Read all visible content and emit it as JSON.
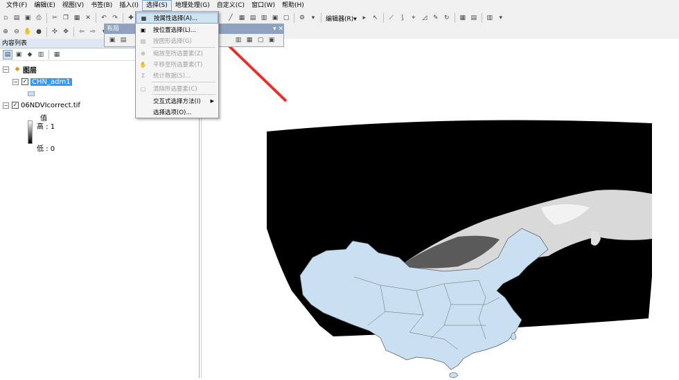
{
  "menu": {
    "items": [
      "文件(F)",
      "编辑(E)",
      "视图(V)",
      "书签(B)",
      "插入(I)",
      "选择(S)",
      "地理处理(G)",
      "自定义(C)",
      "窗口(W)",
      "帮助(H)"
    ]
  },
  "toolbar": {
    "editor_label": "编辑器(R)▾"
  },
  "toc": {
    "title": "内容列表",
    "group_label": "图层",
    "layer1": "CHN_adm1",
    "layer2": "06NDVIcorrect.tif",
    "legend_header": "值",
    "legend_high": "高 : 1",
    "legend_low": "低 : 0"
  },
  "layout_toolbar": {
    "title": "布局",
    "controls": "▾ ✕"
  },
  "dropdown": {
    "items": [
      {
        "label": "按属性选择(A)...",
        "state": "highlighted"
      },
      {
        "label": "按位置选择(L)...",
        "state": "enabled"
      },
      {
        "label": "按图形选择(G)",
        "state": "disabled"
      },
      {
        "label": "缩放至所选要素(Z)",
        "state": "disabled"
      },
      {
        "label": "平移至所选要素(T)",
        "state": "disabled"
      },
      {
        "label": "统计数据(S)...",
        "state": "disabled"
      },
      {
        "label": "清除所选要素(C)",
        "state": "disabled"
      },
      {
        "label": "交互式选择方法(I)",
        "state": "enabled"
      },
      {
        "label": "选择选项(O)...",
        "state": "enabled"
      }
    ]
  },
  "colors": {
    "map_fill": "#c8e0f0",
    "raster_bg": "#000000",
    "arrow": "#e8302a",
    "selection": "#3399ff"
  }
}
